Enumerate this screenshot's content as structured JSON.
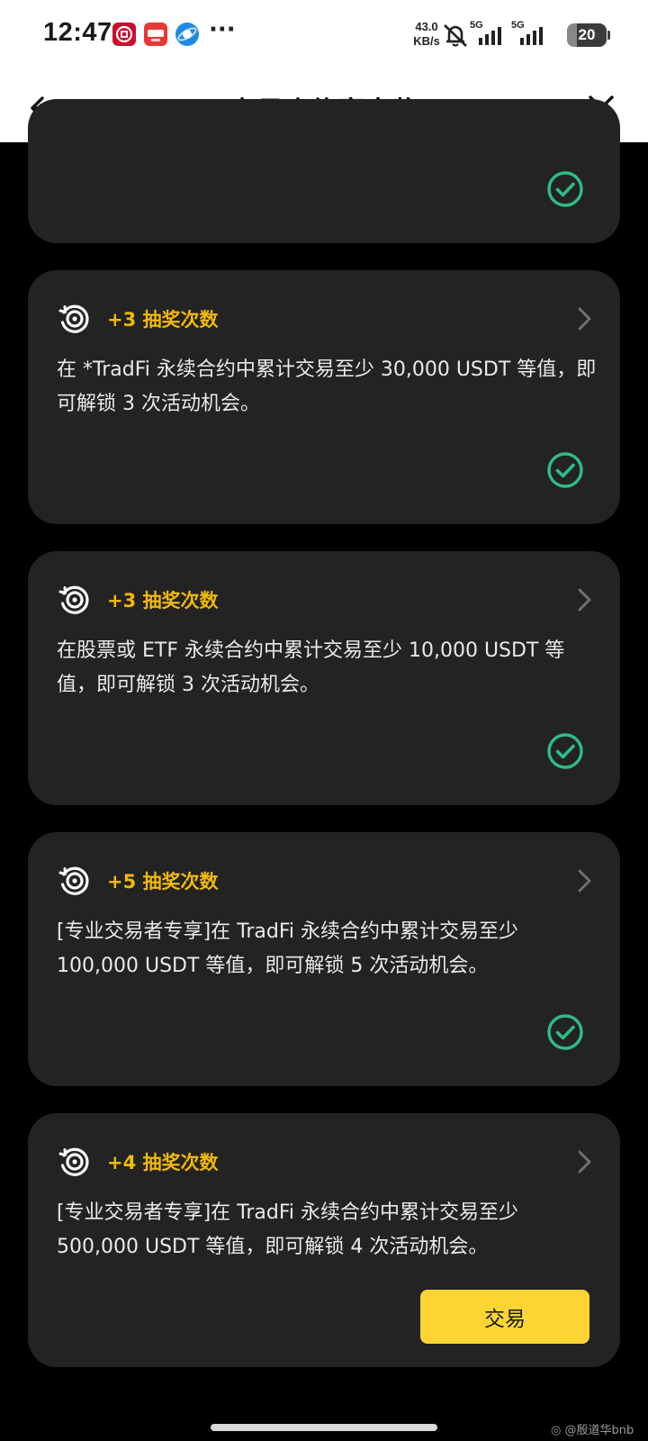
{
  "status_bar": {
    "time": "12:47",
    "app_icons": [
      "bank-app-icon",
      "app-badge-icon",
      "browser-icon"
    ],
    "more": "···",
    "net_speed_value": "43.0",
    "net_speed_unit": "KB/s",
    "signal_label_1": "5G",
    "signal_label_2": "5G",
    "battery_level": "20"
  },
  "header": {
    "title": "交易合约赢大奖",
    "back_icon": "arrow-left-icon",
    "close_icon": "close-icon"
  },
  "tasks": [
    {
      "reward": "",
      "description": "",
      "completed": true
    },
    {
      "reward": "+3 抽奖次数",
      "description": "在 *TradFi 永续合约中累计交易至少 30,000 USDT 等值，即可解锁 3 次活动机会。",
      "completed": true
    },
    {
      "reward": "+3 抽奖次数",
      "description": "在股票或 ETF 永续合约中累计交易至少 10,000 USDT 等值，即可解锁 3 次活动机会。",
      "completed": true
    },
    {
      "reward": "+5 抽奖次数",
      "description": "[专业交易者专享]在 TradFi 永续合约中累计交易至少 100,000 USDT 等值，即可解锁 5 次活动机会。",
      "completed": true
    },
    {
      "reward": "+4 抽奖次数",
      "description": "[专业交易者专享]在 TradFi 永续合约中累计交易至少 500,000 USDT 等值，即可解锁 4 次活动机会。",
      "completed": false,
      "action_label": "交易"
    }
  ],
  "watermark": "◎ @殷道华bnb",
  "colors": {
    "accent_yellow": "#f0b90b",
    "button_yellow": "#fcd535",
    "success_green": "#2ebd85",
    "card_bg": "#232323",
    "page_bg": "#000000"
  }
}
